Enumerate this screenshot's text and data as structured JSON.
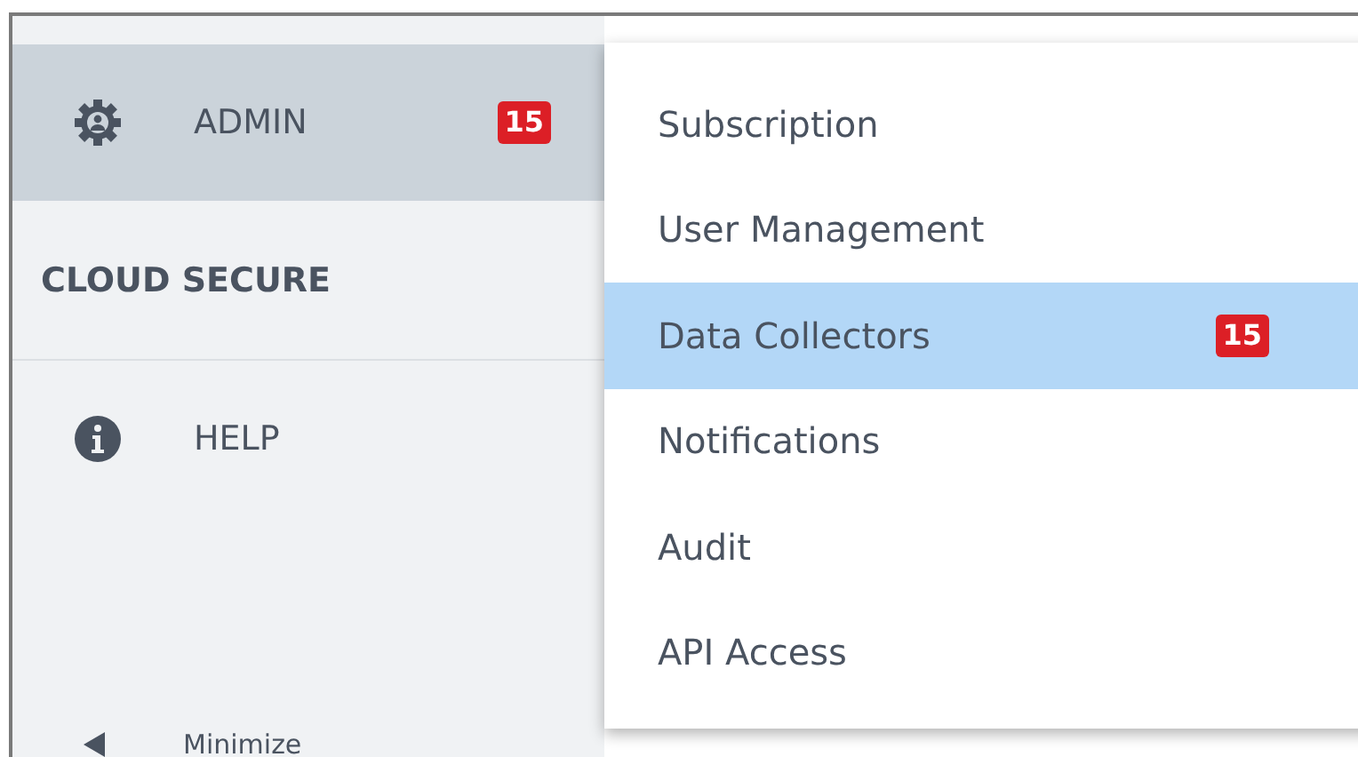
{
  "sidebar": {
    "items": [
      {
        "kind": "nav",
        "label": "ADMIN",
        "badge": "15",
        "selected": true
      },
      {
        "kind": "section",
        "label": "CLOUD SECURE"
      },
      {
        "kind": "nav",
        "label": "HELP",
        "selected": false
      }
    ],
    "minimize": {
      "label": "Minimize"
    }
  },
  "submenu": {
    "items": [
      {
        "label": "Subscription",
        "selected": false
      },
      {
        "label": "User Management",
        "selected": false
      },
      {
        "label": "Data Collectors",
        "badge": "15",
        "selected": true
      },
      {
        "label": "Notifications",
        "selected": false
      },
      {
        "label": "Audit",
        "selected": false
      },
      {
        "label": "API Access",
        "selected": false
      }
    ]
  }
}
